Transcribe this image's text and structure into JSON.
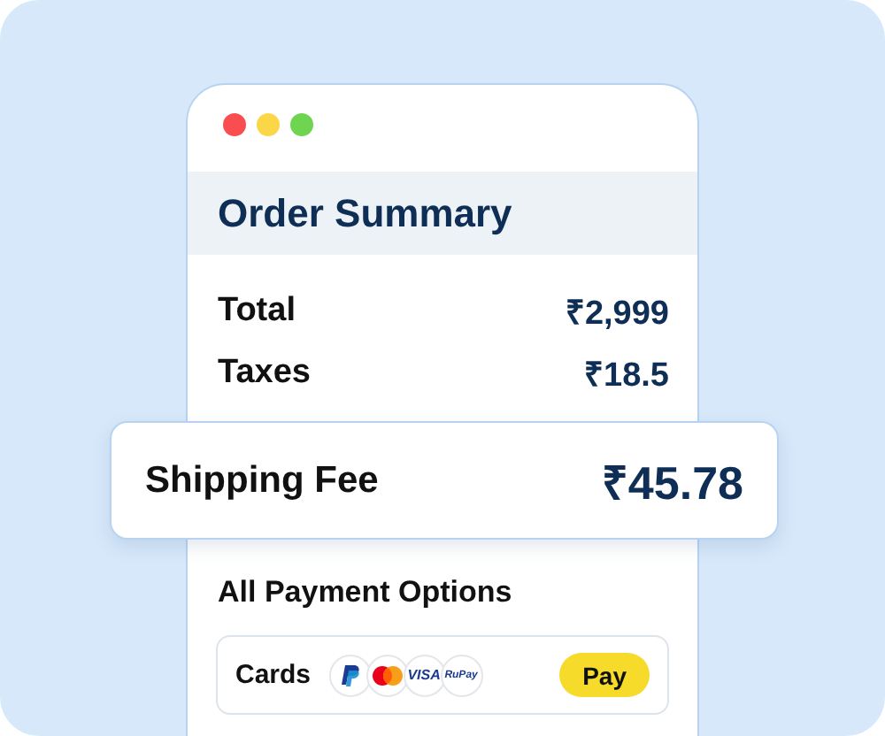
{
  "window": {
    "title": "Order Summary"
  },
  "lines": [
    {
      "label": "Total",
      "value": "₹2,999"
    },
    {
      "label": "Taxes",
      "value": "₹18.5"
    }
  ],
  "highlight": {
    "label": "Shipping Fee",
    "value": "₹45.78"
  },
  "payment": {
    "title": "All Payment Options",
    "method": "Cards",
    "brands": [
      {
        "kind": "paypal"
      },
      {
        "kind": "mastercard"
      },
      {
        "kind": "visa",
        "text": "VISA"
      },
      {
        "kind": "rupay",
        "text": "RuPay"
      }
    ],
    "button": "Pay"
  }
}
